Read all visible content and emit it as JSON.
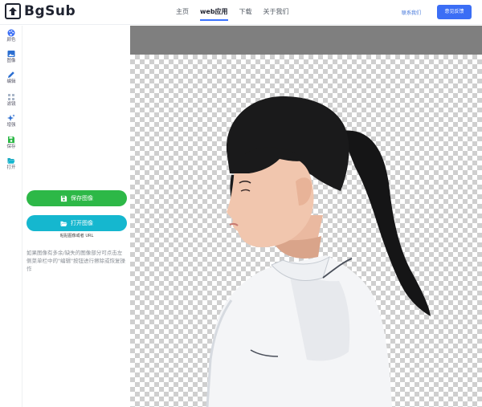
{
  "header": {
    "logo_text": "BgSub",
    "nav": [
      {
        "label": "主页",
        "active": false
      },
      {
        "label": "web应用",
        "active": true
      },
      {
        "label": "下载",
        "active": false
      },
      {
        "label": "关于我们",
        "active": false
      }
    ],
    "contact_label": "联系我们",
    "feedback_label": "意见反馈"
  },
  "rail": {
    "items": [
      {
        "label": "颜色",
        "icon": "palette-icon"
      },
      {
        "label": "图像",
        "icon": "image-icon"
      },
      {
        "label": "编辑",
        "icon": "pencil-icon"
      },
      {
        "label": "滤镜",
        "icon": "filter-icon"
      },
      {
        "label": "增强",
        "icon": "sparkle-icon"
      },
      {
        "label": "保存",
        "icon": "save-icon"
      },
      {
        "label": "打开",
        "icon": "folder-open-icon"
      }
    ]
  },
  "panel": {
    "save_label": "保存图像",
    "open_label": "打开图像",
    "paste_hint": "粘贴图像或者 URL",
    "help_text": "如果图像有多余/缺失的图像部分可点击左侧菜单栏中的\"编辑\"按钮进行擦除或恢复操作"
  },
  "colors": {
    "accent": "#3b6ef5",
    "save_green": "#2db847",
    "open_cyan": "#15b7cf",
    "canvas_header": "#7f7f7f"
  }
}
